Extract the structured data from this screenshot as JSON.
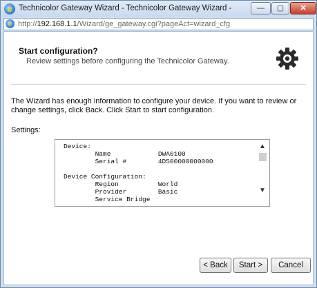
{
  "window": {
    "title": "Technicolor Gateway Wizard - Technicolor Gateway Wizard - Internet E...",
    "minimize_glyph": "—",
    "maximize_glyph": "▢",
    "close_glyph": "✕"
  },
  "address": {
    "prefix": "http://",
    "host": "192.168.1.1",
    "path": "/Wizard/ge_gateway.cgi?pageAct=wizard_cfg"
  },
  "wizard": {
    "step_title": "Start configuration?",
    "step_subtitle": "Review settings before configuring the Technicolor Gateway.",
    "description": "The Wizard has enough information to configure your device. If you want to review or change settings, click Back. Click Start to start configuration.",
    "settings_label": "Settings:",
    "settings_text": "Device:\n        Name            DWA0100\n        Serial #        4D500000000000\n\nDevice Configuration:\n        Region          World\n        Provider        Basic\n        Service Bridge"
  },
  "buttons": {
    "back": "< Back",
    "start": "Start >",
    "cancel": "Cancel"
  },
  "icons": {
    "app": "internet-explorer-icon",
    "gear": "gear-icon"
  }
}
